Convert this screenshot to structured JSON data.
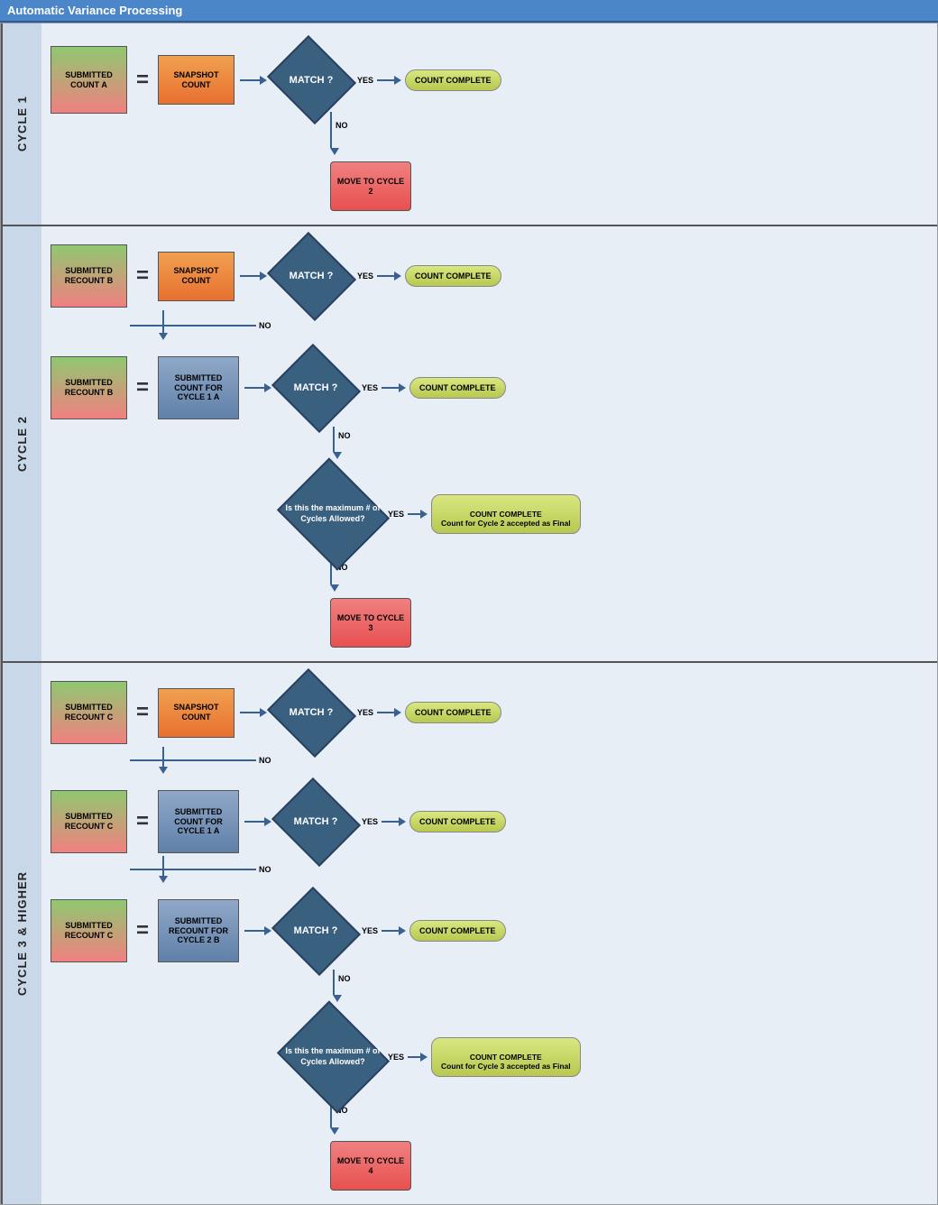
{
  "title": "Automatic Variance Processing",
  "cycles": [
    {
      "id": "cycle1",
      "label": "CYCLE 1",
      "rows": [
        {
          "id": "row1",
          "submitted_box": "SUBMITTED COUNT A",
          "snapshot_box": "SNAPSHOT COUNT",
          "diamond": "MATCH ?",
          "yes_label": "YES",
          "no_label": "NO",
          "complete_label": "COUNT COMPLETE",
          "move_to": "Move to Cycle 2"
        }
      ]
    },
    {
      "id": "cycle2",
      "label": "CYCLE 2",
      "rows": [
        {
          "id": "row1",
          "submitted_box": "SUBMITTED RECOUNT B",
          "snapshot_box": "SNAPSHOT COUNT",
          "diamond": "MATCH ?",
          "yes_label": "YES",
          "no_label": "NO",
          "complete_label": "COUNT COMPLETE"
        },
        {
          "id": "row2",
          "submitted_box": "SUBMITTED RECOUNT B",
          "compare_box": "SUBMITTED COUNT FOR CYCLE 1 A",
          "diamond": "MATCH ?",
          "yes_label": "YES",
          "no_label": "NO",
          "complete_label": "COUNT COMPLETE"
        },
        {
          "id": "row3",
          "diamond_max": "Is this the maximum # of Cycles Allowed?",
          "yes_label": "YES",
          "no_label": "NO",
          "complete_label": "COUNT COMPLETE\nCount for Cycle 2 accepted as Final",
          "move_to": "Move to Cycle 3"
        }
      ]
    },
    {
      "id": "cycle3",
      "label": "CYCLE 3 & HIGHER",
      "rows": [
        {
          "id": "row1",
          "submitted_box": "SUBMITTED RECOUNT C",
          "snapshot_box": "SNAPSHOT COUNT",
          "diamond": "MATCH ?",
          "yes_label": "YES",
          "no_label": "NO",
          "complete_label": "COUNT COMPLETE"
        },
        {
          "id": "row2",
          "submitted_box": "SUBMITTED RECOUNT C",
          "compare_box": "SUBMITTED COUNT FOR CYCLE 1 A",
          "diamond": "MATCH ?",
          "yes_label": "YES",
          "no_label": "NO",
          "complete_label": "COUNT COMPLETE"
        },
        {
          "id": "row3",
          "submitted_box": "SUBMITTED RECOUNT C",
          "compare_box2": "SUBMITTED RECOUNT FOR CYCLE 2 B",
          "diamond": "MATCH ?",
          "yes_label": "YES",
          "no_label": "NO",
          "complete_label": "COUNT COMPLETE"
        },
        {
          "id": "row4",
          "diamond_max": "Is this the maximum # of Cycles Allowed?",
          "yes_label": "YES",
          "no_label": "NO",
          "complete_label": "COUNT COMPLETE\nCount for Cycle 3 accepted as Final",
          "move_to": "Move to Cycle 4"
        }
      ]
    }
  ]
}
